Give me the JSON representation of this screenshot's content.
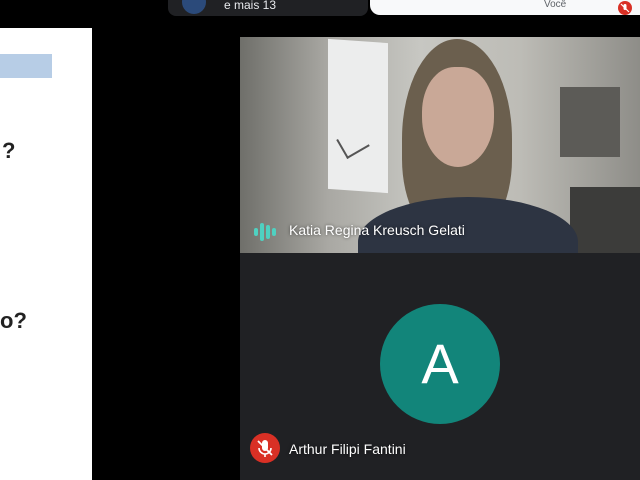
{
  "top_bar": {
    "others_label": "e mais 13",
    "self_label": "Você"
  },
  "presentation": {
    "question_mark_1": "?",
    "question_mark_2": "o?"
  },
  "participants": [
    {
      "name": "Katia Regina Kreusch Gelati",
      "status": "speaking"
    },
    {
      "name": "Arthur Filipi Fantini",
      "status": "muted",
      "avatar_letter": "A",
      "avatar_color": "#12857a"
    }
  ],
  "colors": {
    "speaking_accent": "#4fd1c1",
    "muted_badge": "#d93025",
    "tile_background": "#202124"
  }
}
